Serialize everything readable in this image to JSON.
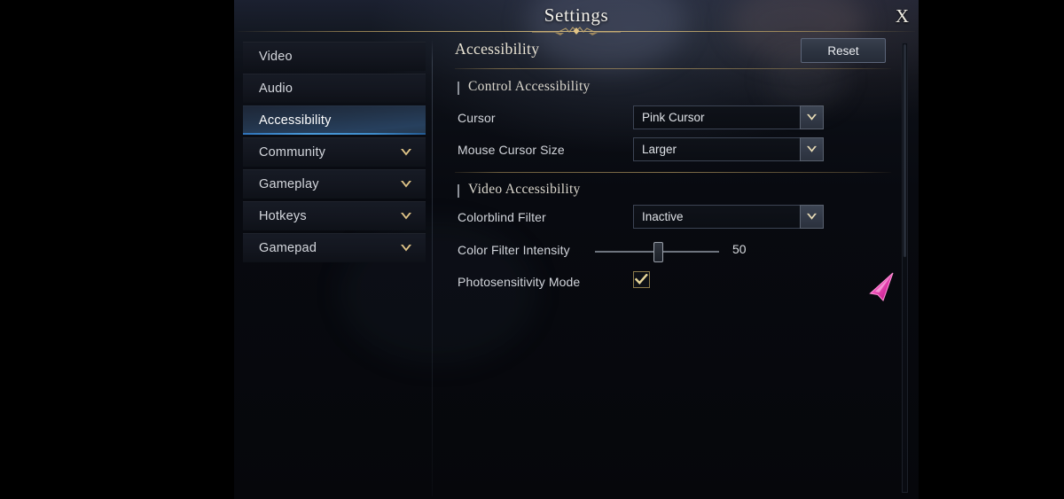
{
  "window": {
    "title": "Settings",
    "close_label": "X"
  },
  "sidebar": {
    "items": [
      {
        "label": "Video",
        "selected": false,
        "expandable": false
      },
      {
        "label": "Audio",
        "selected": false,
        "expandable": false
      },
      {
        "label": "Accessibility",
        "selected": true,
        "expandable": false
      },
      {
        "label": "Community",
        "selected": false,
        "expandable": true
      },
      {
        "label": "Gameplay",
        "selected": false,
        "expandable": true
      },
      {
        "label": "Hotkeys",
        "selected": false,
        "expandable": true
      },
      {
        "label": "Gamepad",
        "selected": false,
        "expandable": true
      }
    ]
  },
  "panel": {
    "title": "Accessibility",
    "reset_label": "Reset",
    "sections": [
      {
        "title": "Control Accessibility"
      },
      {
        "title": "Video Accessibility"
      }
    ],
    "rows": {
      "cursor": {
        "label": "Cursor",
        "value": "Pink Cursor"
      },
      "cursor_size": {
        "label": "Mouse Cursor Size",
        "value": "Larger"
      },
      "colorblind": {
        "label": "Colorblind Filter",
        "value": "Inactive"
      },
      "intensity": {
        "label": "Color Filter Intensity",
        "value": "50",
        "min": "0",
        "max": "100"
      },
      "photosensitivity": {
        "label": "Photosensitivity Mode",
        "checked": "true"
      }
    }
  },
  "colors": {
    "gold": "#b29860",
    "accent_blue": "#4a9ada",
    "cursor_pink": "#ef3fb5",
    "text_light": "#d4d7dd"
  }
}
